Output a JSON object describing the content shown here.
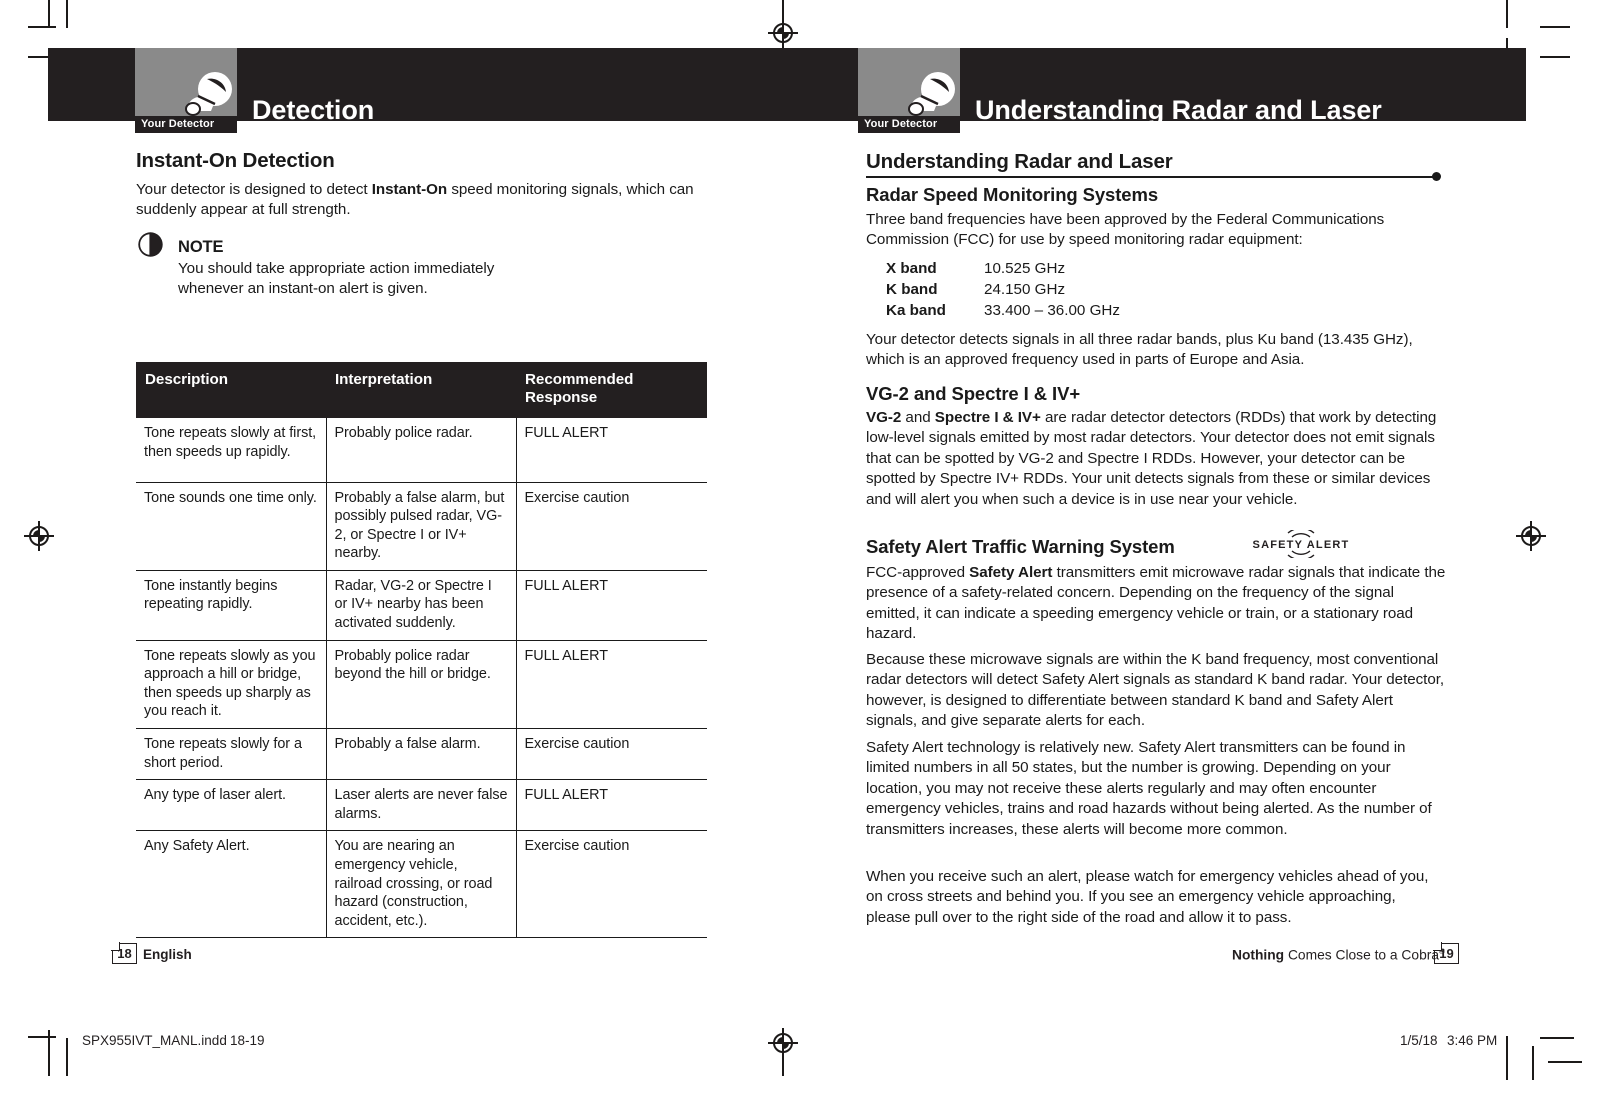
{
  "spread": {
    "left_page": {
      "tab_label": "Your Detector",
      "header_title": "Detection",
      "section_title": "Instant-On Detection",
      "intro_parts": [
        {
          "text": "Your detector is designed to detect ",
          "bold": false
        },
        {
          "text": "Instant-On",
          "bold": true
        },
        {
          "text": " speed monitoring signals, which can suddenly appear at full strength.",
          "bold": false
        }
      ],
      "note": {
        "label": "NOTE",
        "body": "You should take appropriate action immediately whenever an instant-on alert is given."
      },
      "table": {
        "headers": [
          "Description",
          "Interpretation",
          "Recommended Response"
        ],
        "rows": [
          {
            "description": "Tone repeats slowly at first, then speeds up rapidly.",
            "interpretation": "Probably police radar.",
            "response": "FULL ALERT"
          },
          {
            "description": "Tone sounds one time only.",
            "interpretation": "Probably a false alarm, but possibly pulsed radar, VG-2, or Spectre I or IV+ nearby.",
            "response": "Exercise caution"
          },
          {
            "description": "Tone instantly begins repeating rapidly.",
            "interpretation": "Radar, VG-2 or Spectre I or IV+ nearby has been activated suddenly.",
            "response": "FULL ALERT"
          },
          {
            "description": "Tone repeats slowly as you approach a hill or bridge, then speeds up sharply as you reach it.",
            "interpretation": "Probably police radar beyond the hill or bridge.",
            "response": "FULL ALERT"
          },
          {
            "description": "Tone repeats slowly for a short period.",
            "interpretation": "Probably a false alarm.",
            "response": "Exercise caution"
          },
          {
            "description": "Any type of laser alert.",
            "interpretation": "Laser alerts are never false alarms.",
            "response": "FULL ALERT"
          },
          {
            "description": "Any Safety Alert.",
            "interpretation": "You are nearing an emergency vehicle, railroad crossing, or road hazard (construction, accident, etc.).",
            "response": "Exercise caution"
          }
        ]
      },
      "footer": {
        "page_number": "18",
        "language": "English"
      }
    },
    "right_page": {
      "tab_label": "Your Detector",
      "header_title": "Understanding Radar and Laser",
      "section_title": "Understanding Radar and Laser",
      "subsections": [
        {
          "heading": "Radar Speed Monitoring Systems",
          "paragraph": "Three band frequencies have been approved by the Federal Communications Commission (FCC) for use by speed monitoring radar equipment:"
        }
      ],
      "bands": [
        {
          "name": "X band",
          "frequency": "10.525 GHz"
        },
        {
          "name": "K band",
          "frequency": "24.150 GHz"
        },
        {
          "name": "Ka band",
          "frequency": "33.400 – 36.00 GHz"
        }
      ],
      "band_note": "Your detector detects signals in all three radar bands, plus Ku band (13.435 GHz), which is an approved frequency used in parts of Europe and Asia.",
      "vg2_heading": "VG-2 and Spectre I & IV+",
      "vg2_parts": [
        {
          "text": "VG-2",
          "bold": true
        },
        {
          "text": " and ",
          "bold": false
        },
        {
          "text": "Spectre I & IV+",
          "bold": true
        },
        {
          "text": " are radar detector detectors (RDDs) that work by detecting low-level signals emitted by most radar detectors. Your detector does not emit signals that can be spotted by VG-2 and Spectre I RDDs. However, your detector can be spotted by Spectre IV+ RDDs. Your unit detects signals from these or similar devices and will alert you when such a device is in use near your vehicle.",
          "bold": false
        }
      ],
      "safety_heading": "Safety Alert Traffic Warning System",
      "safety_logo_text": "SAFETY ALERT",
      "safety_para1_parts": [
        {
          "text": "FCC-approved ",
          "bold": false
        },
        {
          "text": "Safety Alert",
          "bold": true
        },
        {
          "text": " transmitters emit microwave radar signals that indicate the presence of a safety-related concern. Depending on the frequency of the signal emitted, it can indicate a speeding emergency vehicle or train, or a stationary road hazard.",
          "bold": false
        }
      ],
      "safety_para2": "Because these microwave signals are within the K band frequency, most conventional radar detectors will detect Safety Alert signals as standard K band radar. Your detector, however, is designed to differentiate between standard K band and Safety Alert signals, and give separate alerts for each.",
      "safety_para3": "Safety Alert technology is relatively new. Safety Alert transmitters can be found in limited numbers in all 50 states, but the number is growing. Depending on your location, you may not receive these alerts regularly and may often encounter emergency vehicles, trains and road hazards without being alerted. As the number of transmitters increases, these alerts will become more common.",
      "safety_para4": "When you receive such an alert, please watch for emergency vehicles ahead of you, on cross streets and behind you. If you see an emergency vehicle approaching, please pull over to the right side of the road and allow it to pass.",
      "footer": {
        "tagline_bold": "Nothing",
        "tagline_rest": " Comes Close to a Cobra",
        "tagline_sup": "®",
        "page_number": "19"
      }
    }
  },
  "print_meta": {
    "filename": "SPX955IVT_MANL.indd",
    "page_range": "18-19",
    "date": "1/5/18",
    "time": "3:46 PM"
  },
  "colors": {
    "header_black": "#231f20",
    "tab_gray": "#8a8a8a",
    "text_black": "#1a1a1a",
    "paper_white": "#ffffff"
  }
}
